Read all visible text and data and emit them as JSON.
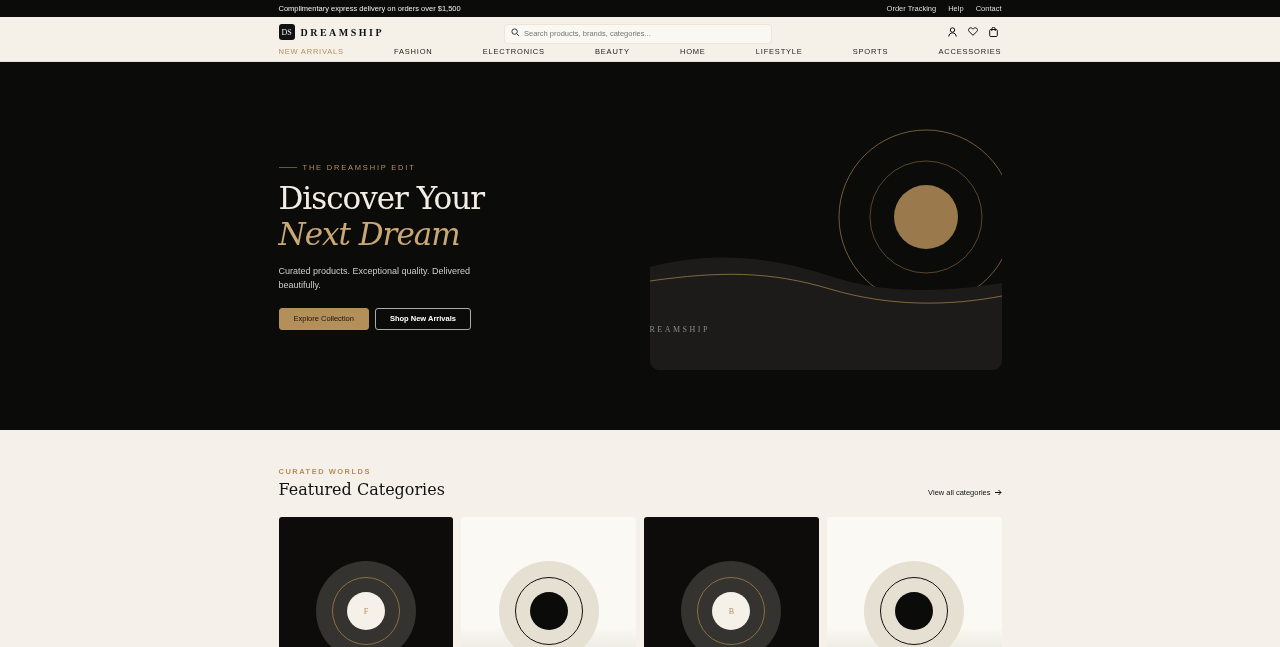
{
  "top_bar": {
    "promo": "Complimentary express delivery on orders over $1,500",
    "links": [
      "Order Tracking",
      "Help",
      "Contact"
    ]
  },
  "header": {
    "logo_mark": "DS",
    "logo_text": "DREAMSHIP",
    "search": {
      "placeholder": "Search products, brands, categories..."
    }
  },
  "nav": [
    {
      "label": "NEW ARRIVALS",
      "selected": true
    },
    {
      "label": "FASHION",
      "selected": false
    },
    {
      "label": "ELECTRONICS",
      "selected": false
    },
    {
      "label": "BEAUTY",
      "selected": false
    },
    {
      "label": "HOME",
      "selected": false
    },
    {
      "label": "LIFESTYLE",
      "selected": false
    },
    {
      "label": "SPORTS",
      "selected": false
    },
    {
      "label": "ACCESSORIES",
      "selected": false
    }
  ],
  "hero": {
    "eyebrow": "THE DREAMSHIP EDIT",
    "title_line_1": "Discover Your",
    "title_line_2": "Next Dream",
    "subtitle": "Curated products. Exceptional quality. Delivered beautifully.",
    "buttons": [
      "Explore Collection",
      "Shop New Arrivals"
    ],
    "art_text": "REAMSHIP"
  },
  "categories": {
    "eyebrow": "CURATED WORLDS",
    "title": "Featured Categories",
    "view_all": "View all categories",
    "cards": [
      {
        "kind": "dark",
        "letter": "F"
      },
      {
        "kind": "light"
      },
      {
        "kind": "dark",
        "letter": "B"
      },
      {
        "kind": "light"
      }
    ]
  }
}
